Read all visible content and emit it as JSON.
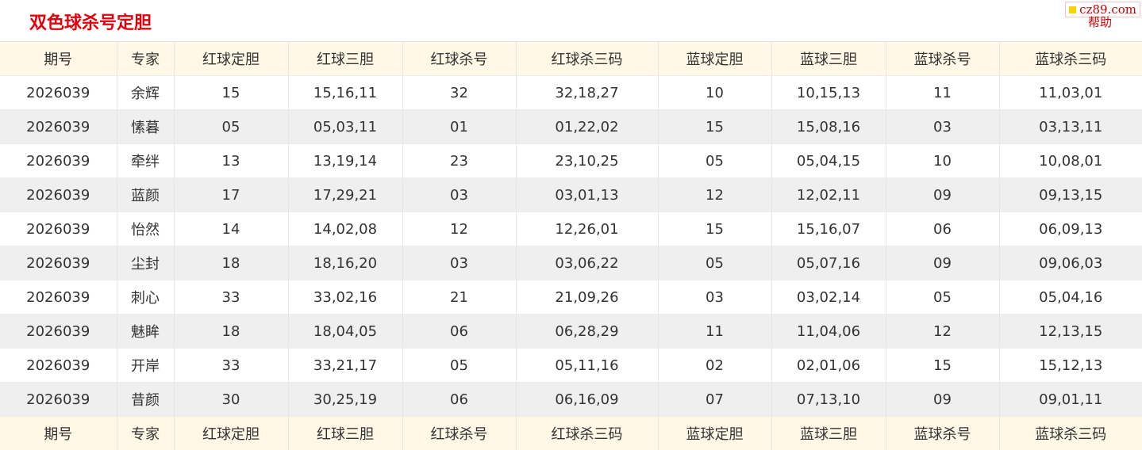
{
  "page": {
    "title": "双色球杀号定胆",
    "brand": "cz89.com",
    "help": "帮助"
  },
  "table": {
    "headers": [
      "期号",
      "专家",
      "红球定胆",
      "红球三胆",
      "红球杀号",
      "红球杀三码",
      "蓝球定胆",
      "蓝球三胆",
      "蓝球杀号",
      "蓝球杀三码"
    ],
    "rows": [
      [
        "2026039",
        "余辉",
        "15",
        "15,16,11",
        "32",
        "32,18,27",
        "10",
        "10,15,13",
        "11",
        "11,03,01"
      ],
      [
        "2026039",
        "愫暮",
        "05",
        "05,03,11",
        "01",
        "01,22,02",
        "15",
        "15,08,16",
        "03",
        "03,13,11"
      ],
      [
        "2026039",
        "牵绊",
        "13",
        "13,19,14",
        "23",
        "23,10,25",
        "05",
        "05,04,15",
        "10",
        "10,08,01"
      ],
      [
        "2026039",
        "蓝颜",
        "17",
        "17,29,21",
        "03",
        "03,01,13",
        "12",
        "12,02,11",
        "09",
        "09,13,15"
      ],
      [
        "2026039",
        "怡然",
        "14",
        "14,02,08",
        "12",
        "12,26,01",
        "15",
        "15,16,07",
        "06",
        "06,09,13"
      ],
      [
        "2026039",
        "尘封",
        "18",
        "18,16,20",
        "03",
        "03,06,22",
        "05",
        "05,07,16",
        "09",
        "09,06,03"
      ],
      [
        "2026039",
        "刺心",
        "33",
        "33,02,16",
        "21",
        "21,09,26",
        "03",
        "03,02,14",
        "05",
        "05,04,16"
      ],
      [
        "2026039",
        "魅眸",
        "18",
        "18,04,05",
        "06",
        "06,28,29",
        "11",
        "11,04,06",
        "12",
        "12,13,15"
      ],
      [
        "2026039",
        "开岸",
        "33",
        "33,21,17",
        "05",
        "05,11,16",
        "02",
        "02,01,06",
        "15",
        "15,12,13"
      ],
      [
        "2026039",
        "昔颜",
        "30",
        "30,25,19",
        "06",
        "06,16,09",
        "07",
        "07,13,10",
        "09",
        "09,01,11"
      ]
    ]
  },
  "colors": {
    "title": "#e3000b",
    "header_bg": "#fff8e7",
    "row_alt_bg": "#efefef",
    "text": "#333333"
  }
}
